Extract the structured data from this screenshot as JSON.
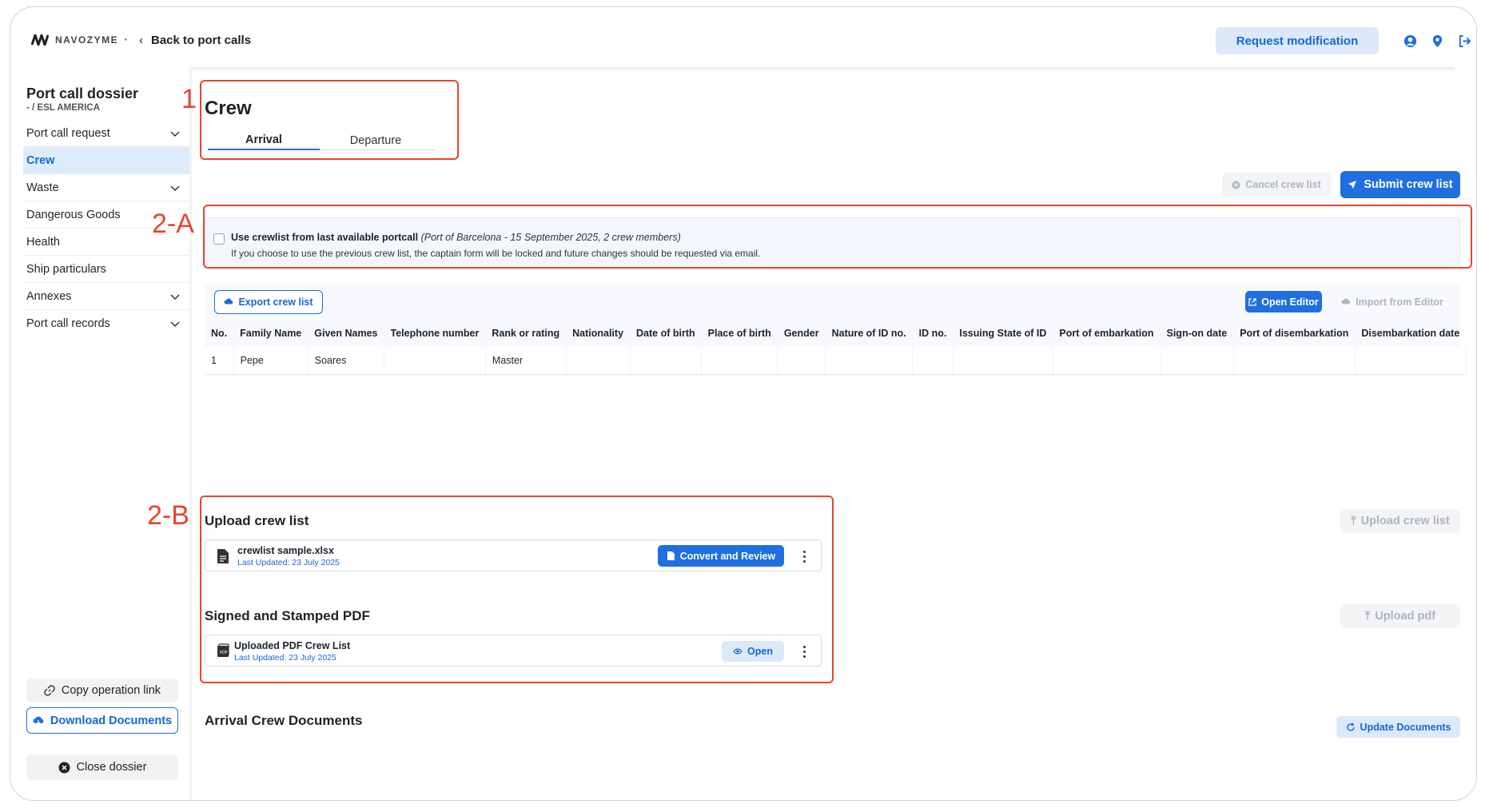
{
  "header": {
    "logo_text": "NAVOZYME",
    "back_label": "Back to port calls",
    "request_button": "Request modification",
    "icons": [
      "user-icon",
      "location-pin-icon",
      "logout-icon"
    ]
  },
  "sidebar": {
    "title": "Port call dossier",
    "subtitle": "- / ESL AMERICA",
    "items": [
      {
        "label": "Port call request",
        "expandable": true
      },
      {
        "label": "Crew",
        "expandable": false,
        "active": true
      },
      {
        "label": "Waste",
        "expandable": true
      },
      {
        "label": "Dangerous Goods",
        "expandable": false
      },
      {
        "label": "Health",
        "expandable": false
      },
      {
        "label": "Ship particulars",
        "expandable": false
      },
      {
        "label": "Annexes",
        "expandable": true
      },
      {
        "label": "Port call records",
        "expandable": true
      }
    ],
    "copy_link": "Copy operation link",
    "download_docs": "Download Documents",
    "close_dossier": "Close dossier"
  },
  "main": {
    "title": "Crew",
    "tabs": [
      {
        "label": "Arrival",
        "active": true
      },
      {
        "label": "Departure",
        "active": false
      }
    ],
    "cancel_button": "Cancel crew list",
    "submit_button": "Submit crew list",
    "notice": {
      "checkbox_label": "Use crewlist from last available portcall",
      "checkbox_detail": "(Port of Barcelona - 15 September 2025, 2 crew members)",
      "checked": false,
      "info": "If you choose to use the previous crew list, the captain form will be locked and future changes should be requested via email."
    },
    "export_button": "Export crew list",
    "open_editor_button": "Open Editor",
    "import_editor_button": "Import from Editor",
    "table": {
      "columns": [
        "No.",
        "Family Name",
        "Given Names",
        "Telephone number",
        "Rank or rating",
        "Nationality",
        "Date of birth",
        "Place of birth",
        "Gender",
        "Nature of ID no.",
        "ID no.",
        "Issuing State of ID",
        "Port of embarkation",
        "Sign-on date",
        "Port of disembarkation",
        "Disembarkation date"
      ],
      "rows": [
        [
          "1",
          "Pepe",
          "Soares",
          "",
          "Master",
          "",
          "",
          "",
          "",
          "",
          "",
          "",
          "",
          "",
          "",
          ""
        ]
      ]
    },
    "upload_crew": {
      "title": "Upload crew list",
      "upload_button": "Upload crew list",
      "file_name": "crewlist sample.xlsx",
      "file_date": "Last Updated: 23 July 2025",
      "action_button": "Convert and Review"
    },
    "signed_pdf": {
      "title": "Signed and Stamped PDF",
      "upload_button": "Upload pdf",
      "file_name": "Uploaded PDF Crew List",
      "file_date": "Last Updated: 23 July 2025",
      "action_button": "Open"
    },
    "arrival_docs": {
      "title": "Arrival Crew Documents",
      "update_button": "Update Documents"
    }
  },
  "annotations": {
    "label_1": "1",
    "label_2a": "2-A",
    "label_2b": "2-B",
    "color": "#e8442e"
  },
  "colors": {
    "accent": "#1f6fe0",
    "accent_light": "#dbe9fb",
    "annotation": "#e8442e"
  }
}
